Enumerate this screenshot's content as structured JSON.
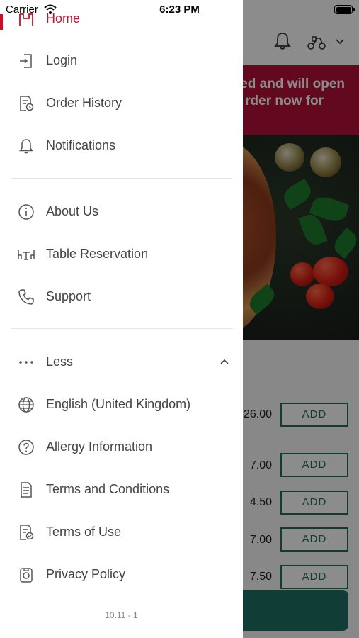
{
  "status_bar": {
    "carrier": "Carrier",
    "time": "6:23 PM"
  },
  "background": {
    "banner_line1": "ed and will open",
    "banner_line2": "rder now for",
    "menu_items": [
      {
        "price": "26.00",
        "add_label": "ADD"
      },
      {
        "price": "7.00",
        "add_label": "ADD"
      },
      {
        "price": "4.50",
        "add_label": "ADD"
      },
      {
        "price": "7.00",
        "add_label": "ADD"
      },
      {
        "price": "7.50",
        "add_label": "ADD"
      }
    ]
  },
  "drawer": {
    "home_label": "Home",
    "items": [
      {
        "label": "Login",
        "icon": "login-icon"
      },
      {
        "label": "Order History",
        "icon": "order-history-icon"
      },
      {
        "label": "Notifications",
        "icon": "bell-icon"
      },
      {
        "label": "About Us",
        "icon": "info-icon"
      },
      {
        "label": "Table Reservation",
        "icon": "table-icon"
      },
      {
        "label": "Support",
        "icon": "phone-icon"
      },
      {
        "label": "Less",
        "icon": "more-dots-icon"
      },
      {
        "label": "English (United Kingdom)",
        "icon": "globe-icon"
      },
      {
        "label": "Allergy Information",
        "icon": "question-icon"
      },
      {
        "label": "Terms and Conditions",
        "icon": "document-icon"
      },
      {
        "label": "Terms of Use",
        "icon": "document-check-icon"
      },
      {
        "label": "Privacy Policy",
        "icon": "privacy-icon"
      }
    ],
    "version": "10.11 - 1"
  },
  "colors": {
    "accent": "#c8102e",
    "banner": "#b3123a",
    "primary_green": "#1f6f53"
  }
}
